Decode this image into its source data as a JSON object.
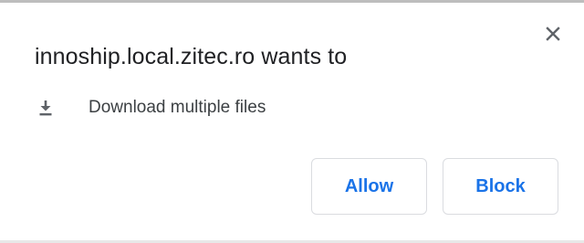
{
  "dialog": {
    "title": "innoship.local.zitec.ro wants to",
    "permission": {
      "icon": "download-icon",
      "label": "Download multiple files"
    },
    "buttons": {
      "allow_label": "Allow",
      "block_label": "Block"
    },
    "close_icon": "close-icon"
  },
  "colors": {
    "accent": "#1a73e8",
    "text": "#202124",
    "border": "#dadce0"
  }
}
